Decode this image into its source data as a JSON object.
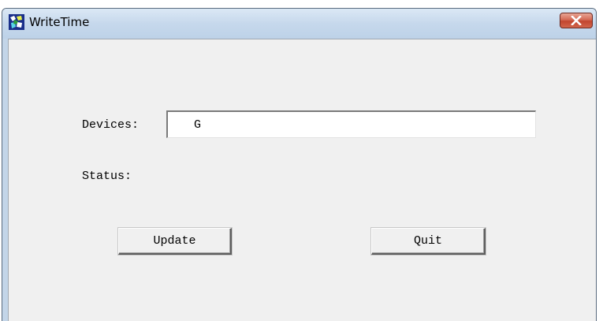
{
  "window": {
    "title": "WriteTime",
    "icon": "writetime-app-icon",
    "close_icon": "close-icon"
  },
  "form": {
    "devices_label": "Devices:",
    "devices_value": "G",
    "status_label": "Status:"
  },
  "buttons": {
    "update_label": "Update",
    "quit_label": "Quit"
  },
  "colors": {
    "titlebar": "#c6d8ec",
    "client_background": "#f0f0f0",
    "close_button": "#c2452f"
  }
}
